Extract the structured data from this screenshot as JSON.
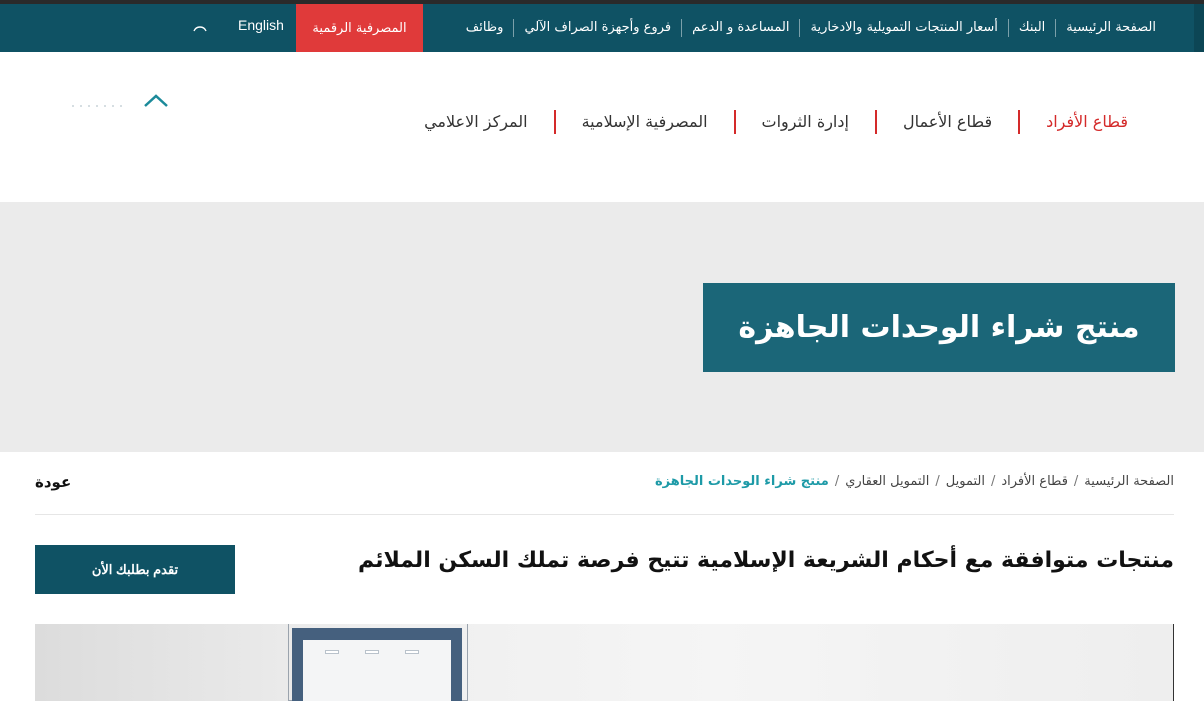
{
  "top_nav": {
    "items": [
      "الصفحة الرئيسية",
      "البنك",
      "أسعار المنتجات التمويلية والادخارية",
      "المساعدة و الدعم",
      "فروع وأجهزة الصراف الآلي",
      "وظائف"
    ],
    "digital_banking": "المصرفية الرقمية",
    "language": "English",
    "search_icon": "search-icon"
  },
  "main_nav": {
    "items": [
      "قطاع الأفراد",
      "قطاع الأعمال",
      "إدارة الثروات",
      "المصرفية الإسلامية",
      "المركز الاعلامي"
    ],
    "active": "قطاع الأفراد"
  },
  "hero": {
    "title": "منتج شراء الوحدات الجاهزة"
  },
  "breadcrumb": {
    "items": [
      "الصفحة الرئيسية",
      "قطاع الأفراد",
      "التمويل",
      "التمويل العقاري",
      "منتج شراء الوحدات الجاهزة"
    ],
    "separator": "/"
  },
  "back": "عودة",
  "intro": {
    "heading": "منتجات متوافقة مع أحكام الشريعة الإسلامية تتيح فرصة تملك السكن الملائم",
    "apply_button": "تقدم بطلبك الأن"
  },
  "colors": {
    "topbar": "#0f5264",
    "accent_red": "#e03a3a",
    "hero_box": "#1b6678",
    "breadcrumb_current": "#1d9aa7"
  }
}
